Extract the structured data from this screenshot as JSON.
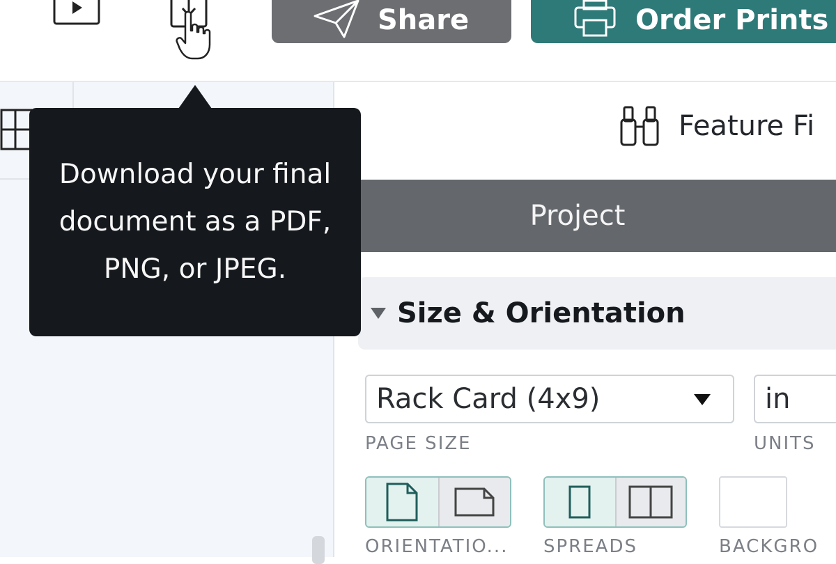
{
  "toolbar": {
    "play_icon": "play-icon",
    "download_icon": "download-icon",
    "share_label": "Share",
    "share_icon": "paper-plane-icon",
    "order_label": "Order Prints",
    "order_icon": "printer-icon"
  },
  "tooltip": {
    "text": "Download your final document as a PDF, PNG, or JPEG."
  },
  "feature_finder": {
    "label": "Feature Fi",
    "icon": "binoculars-icon"
  },
  "panel": {
    "header": "Project",
    "section": "Size & Orientation",
    "page_size": {
      "value": "Rack Card (4x9)",
      "label": "PAGE SIZE"
    },
    "units": {
      "value": "in",
      "label": "UNITS"
    },
    "orientation": {
      "label": "ORIENTATIO...",
      "selected": "portrait"
    },
    "spreads": {
      "label": "SPREADS",
      "selected": "single"
    },
    "background": {
      "label": "BACKGRO"
    }
  },
  "colors": {
    "accent": "#2e7a78",
    "share_button": "#6c6e72",
    "tooltip_bg": "#15191e",
    "project_header": "#64676b"
  }
}
